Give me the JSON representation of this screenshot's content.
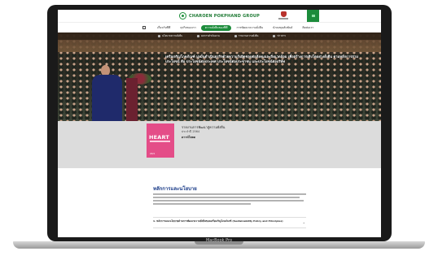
{
  "device": {
    "label": "MacBook Pro"
  },
  "site": {
    "logo_text": "CHAROEN POKPHAND GROUP",
    "nav": [
      {
        "label": "เกี่ยวกับซีพี",
        "active": false
      },
      {
        "label": "ธุรกิจของเรา",
        "active": false
      },
      {
        "label": "ความยั่งยืนของซีพี",
        "active": true
      },
      {
        "label": "การพัฒนาความยั่งยืน",
        "active": false
      },
      {
        "label": "นักลงทุนสัมพันธ์",
        "active": false
      },
      {
        "label": "ติดต่อเรา",
        "active": false
      }
    ],
    "tabs": [
      {
        "label": "นโยบายความยั่งยืน"
      },
      {
        "label": "ผลการดำเนินงาน"
      },
      {
        "label": "รายงานความยั่งยืน"
      },
      {
        "label": "ข่าวสาร"
      }
    ],
    "hero_text": "เครือเจริญโภคภัณฑ์ มุ่งมั่นดำเนินธุรกิจด้วยความรับผิดชอบต่อสังคมและสิ่งแวดล้อม เพื่อสร้างการเติบโตอย่างยั่งยืน ตามหลักการสามประโยชน์ คือ ประโยชน์ต่อประเทศ ประโยชน์ต่อประชาชน และประโยชน์ต่อบริษัท",
    "report": {
      "book_title": "HEART",
      "book_year": "2021",
      "title": "รายงานการพัฒนาสู่ความยั่งยืน",
      "date": "ประจำปี 2564",
      "download_label": "ดาวน์โหลด"
    },
    "section": {
      "title": "หลักการและนโยบาย",
      "item_text": "1. หลักการและนโยบายด้านการพัฒนาความยั่งยืนของเครือเจริญโภคภัณฑ์ (Sustainability Policy and Principles)"
    }
  }
}
